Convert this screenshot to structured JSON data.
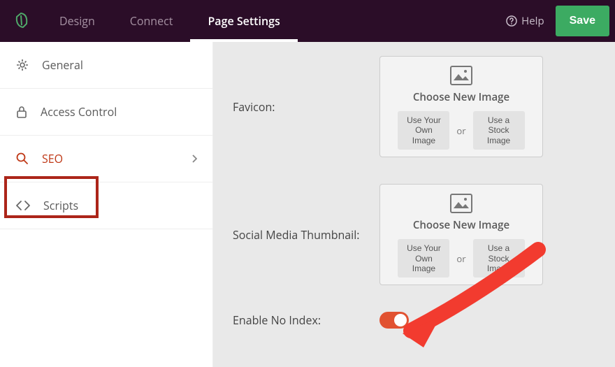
{
  "topbar": {
    "tabs": {
      "design": "Design",
      "connect": "Connect",
      "page_settings": "Page Settings"
    },
    "help": "Help",
    "save": "Save"
  },
  "sidebar": {
    "items": [
      {
        "label": "General"
      },
      {
        "label": "Access Control"
      },
      {
        "label": "SEO"
      },
      {
        "label": "Scripts"
      }
    ]
  },
  "main": {
    "favicon_label": "Favicon:",
    "social_label": "Social Media Thumbnail:",
    "noindex_label": "Enable No Index:",
    "choose": "Choose New Image",
    "own_img": "Use Your Own Image",
    "or": "or",
    "stock_img": "Use a Stock Image"
  }
}
